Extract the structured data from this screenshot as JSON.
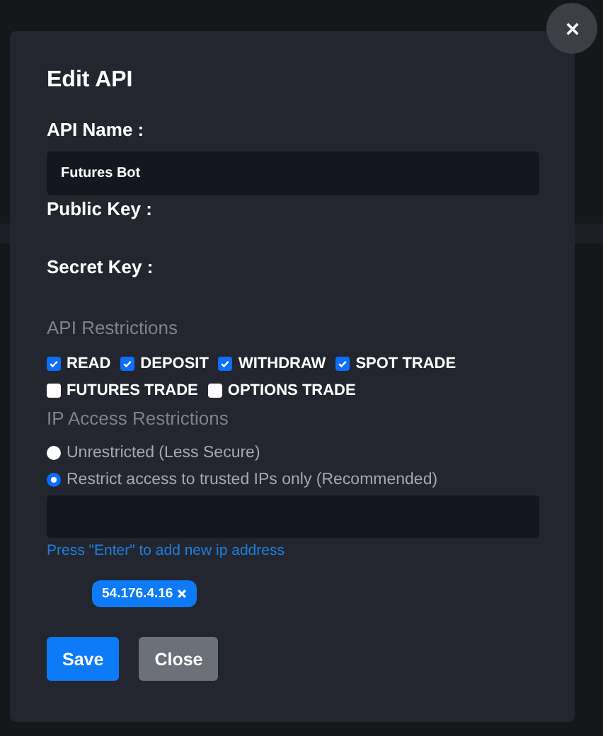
{
  "modal": {
    "title": "Edit API",
    "api_name": {
      "label": "API Name :",
      "value": "Futures Bot"
    },
    "public_key": {
      "label": "Public Key :"
    },
    "secret_key": {
      "label": "Secret Key :"
    },
    "restrictions": {
      "heading": "API Restrictions",
      "permissions": [
        {
          "label": "READ",
          "checked": true
        },
        {
          "label": "DEPOSIT",
          "checked": true
        },
        {
          "label": "WITHDRAW",
          "checked": true
        },
        {
          "label": "SPOT TRADE",
          "checked": true
        },
        {
          "label": "FUTURES TRADE",
          "checked": false
        },
        {
          "label": "OPTIONS TRADE",
          "checked": false
        }
      ]
    },
    "ip_access": {
      "heading": "IP Access Restrictions",
      "options": [
        {
          "label": "Unrestricted (Less Secure)",
          "selected": false
        },
        {
          "label": "Restrict access to trusted IPs only (Recommended)",
          "selected": true
        }
      ],
      "hint": "Press \"Enter\" to add new ip address",
      "ips": [
        {
          "address": "54.176.4.16"
        }
      ]
    },
    "buttons": [
      {
        "label": "Save",
        "kind": "primary"
      },
      {
        "label": "Close",
        "kind": "secondary"
      }
    ]
  }
}
